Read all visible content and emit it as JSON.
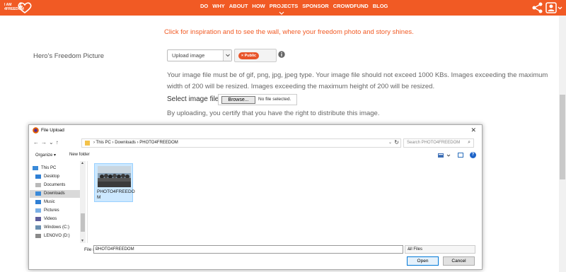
{
  "topbar": {
    "logo_text": "I AM 4FREEDOM",
    "nav": [
      "DO",
      "WHY",
      "ABOUT",
      "HOW",
      "PROJECTS",
      "SPONSOR",
      "CROWDFUND",
      "BLOG"
    ]
  },
  "inspiration_text": "Click for inspiration and to see the wall, where your freedom photo and story shines.",
  "form": {
    "hero_label": "Hero's Freedom Picture",
    "upload_select_value": "Upload image",
    "public_label": "× Public",
    "requirements": "Your image file must be of gif, png, jpg, jpeg type. Your image file should not exceed 1000 KBs. Images exceeding the maximum width of 200 will be resized. Images exceeding the maximum height of 200 will be resized.",
    "select_label": "Select image file",
    "browse_label": "Browse...",
    "no_file_text": "No file selected.",
    "certify_text": "By uploading, you certify that you have the right to distribute this image."
  },
  "dialog": {
    "title": "File Upload",
    "close": "✕",
    "breadcrumb": "›  This PC  ›  Downloads  ›  PHOTO4FREEDOM",
    "search_placeholder": "Search PHOTO4FREEDOM",
    "organize": "Organize ▾",
    "new_folder": "New folder",
    "nav_items": [
      {
        "label": "This PC",
        "icon": "pc-icon"
      },
      {
        "label": "Desktop",
        "icon": "desktop-icon"
      },
      {
        "label": "Documents",
        "icon": "documents-icon"
      },
      {
        "label": "Downloads",
        "icon": "downloads-icon",
        "selected": true
      },
      {
        "label": "Music",
        "icon": "music-icon"
      },
      {
        "label": "Pictures",
        "icon": "pictures-icon"
      },
      {
        "label": "Videos",
        "icon": "videos-icon"
      },
      {
        "label": "Windows (C:)",
        "icon": "drive-icon"
      },
      {
        "label": "LENOVO (D:)",
        "icon": "drive-icon"
      }
    ],
    "file_item": {
      "name": "PHOTO4FREEDO M"
    },
    "file_name_label": "File name:",
    "file_name_value": "PHOTO4FREEDOM",
    "filter_value": "All Files",
    "open_label": "Open",
    "cancel_label": "Cancel"
  },
  "colors": {
    "accent": "#f15a24",
    "selection": "#cce8ff",
    "primary_button_border": "#0078d7"
  }
}
